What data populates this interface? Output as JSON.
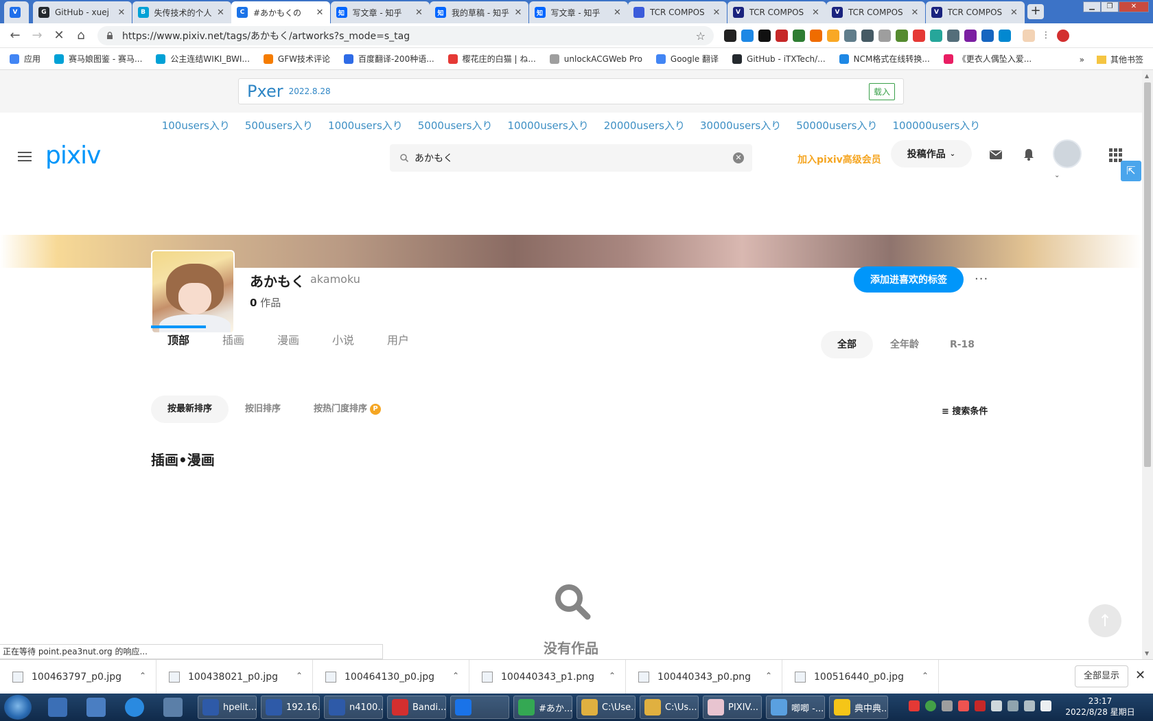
{
  "browser": {
    "tabs": [
      {
        "title": "",
        "color": "#1f6feb",
        "fav": "V",
        "active": false
      },
      {
        "title": "GitHub - xuej",
        "color": "#24292e",
        "fav": "G",
        "active": false
      },
      {
        "title": "失传技术的个人",
        "color": "#00a1d6",
        "fav": "B",
        "active": false
      },
      {
        "title": "#あかもくの",
        "color": "#1a73e8",
        "fav": "C",
        "active": true
      },
      {
        "title": "写文章 - 知乎",
        "color": "#0066ff",
        "fav": "知",
        "active": false
      },
      {
        "title": "我的草稿 - 知乎",
        "color": "#0066ff",
        "fav": "知",
        "active": false
      },
      {
        "title": "写文章 - 知乎",
        "color": "#0066ff",
        "fav": "知",
        "active": false
      },
      {
        "title": "TCR COMPOS",
        "color": "#3b5bdb",
        "fav": "",
        "active": false
      },
      {
        "title": "TCR COMPOS",
        "color": "#1a237e",
        "fav": "V",
        "active": false
      },
      {
        "title": "TCR COMPOS",
        "color": "#1a237e",
        "fav": "V",
        "active": false
      },
      {
        "title": "TCR COMPOS",
        "color": "#1a237e",
        "fav": "V",
        "active": false
      }
    ],
    "new_tab": "+",
    "url": "https://www.pixiv.net/tags/あかもく/artworks?s_mode=s_tag",
    "bookmarks": [
      {
        "label": "应用",
        "color": "#4285f4"
      },
      {
        "label": "赛马娘图鉴 - 赛马...",
        "color": "#00a1d6"
      },
      {
        "label": "公主连结WIKI_BWI...",
        "color": "#00a1d6"
      },
      {
        "label": "GFW技术评论",
        "color": "#f57c00"
      },
      {
        "label": "百度翻译-200种语...",
        "color": "#2e6be6"
      },
      {
        "label": "樱花庄的白猫 | ね...",
        "color": "#e53935"
      },
      {
        "label": "unlockACGWeb Pro",
        "color": "#9e9e9e"
      },
      {
        "label": "Google 翻译",
        "color": "#4285f4"
      },
      {
        "label": "GitHub - iTXTech/...",
        "color": "#24292e"
      },
      {
        "label": "NCM格式在线转换...",
        "color": "#1e88e5"
      },
      {
        "label": "《更衣人偶坠入爱...",
        "color": "#e91e63"
      }
    ],
    "bookmarks_more": "»",
    "other_bookmarks": "其他书签",
    "status_text": "正在等待 point.pea3nut.org 的响应..."
  },
  "pxer": {
    "name": "Pxer",
    "version": "2022.8.28",
    "load_label": "载入"
  },
  "popularity_filters": [
    "100users入り",
    "500users入り",
    "1000users入り",
    "5000users入り",
    "10000users入り",
    "20000users入り",
    "30000users入り",
    "50000users入り",
    "100000users入り"
  ],
  "header": {
    "logo": "pixiv",
    "search_value": "あかもく",
    "premium_label": "加入pixiv高级会员",
    "post_label": "投稿作品"
  },
  "tag": {
    "name": "あかもく",
    "romaji": "akamoku",
    "works_count": "0",
    "works_unit": "作品",
    "fav_button": "添加进喜欢的标签",
    "more": "···"
  },
  "tabs": [
    "顶部",
    "插画",
    "漫画",
    "小说",
    "用户"
  ],
  "age_filters": [
    "全部",
    "全年龄",
    "R-18"
  ],
  "sort_options": [
    "按最新排序",
    "按旧排序",
    "按热门度排序"
  ],
  "premium_badge": "P",
  "search_conditions": "≡ 搜索条件",
  "section_title": "插画•漫画",
  "empty_text": "没有作品",
  "downloads": [
    "100463797_p0.jpg",
    "100438021_p0.jpg",
    "100464130_p0.jpg",
    "100440343_p1.png",
    "100440343_p0.png",
    "100516440_p0.jpg"
  ],
  "show_all_label": "全部显示",
  "taskbar": {
    "tasks": [
      {
        "label": "hpelit...",
        "color": "#2e5aa8"
      },
      {
        "label": "192.16...",
        "color": "#2e5aa8"
      },
      {
        "label": "n4100...",
        "color": "#2e5aa8"
      },
      {
        "label": "Bandi...",
        "color": "#d32f2f"
      },
      {
        "label": "",
        "color": "#1a73e8"
      },
      {
        "label": "#あか...",
        "color": "#34a853"
      },
      {
        "label": "C:\\Use...",
        "color": "#e0b040"
      },
      {
        "label": "C:\\Us...",
        "color": "#e0b040"
      },
      {
        "label": "PIXIV...",
        "color": "#e8c4d0"
      },
      {
        "label": "唧唧 -...",
        "color": "#5aa0e0"
      },
      {
        "label": "典中典...",
        "color": "#f5c518"
      }
    ],
    "time": "23:17",
    "date": "2022/8/28 星期日"
  }
}
